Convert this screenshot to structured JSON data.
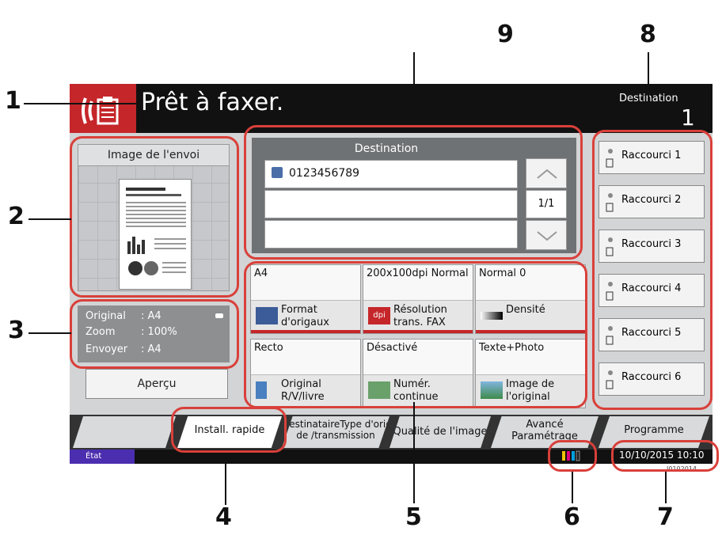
{
  "header": {
    "title": "Prêt à faxer.",
    "destination_label": "Destination",
    "destination_count": "1"
  },
  "preview": {
    "title": "Image de l'envoi"
  },
  "info": {
    "rows": [
      {
        "label": "Original",
        "value": ": A4"
      },
      {
        "label": "Zoom",
        "value": ": 100%"
      },
      {
        "label": "Envoyer",
        "value": ": A4"
      }
    ]
  },
  "apercu_label": "Aperçu",
  "destination_panel": {
    "title": "Destination",
    "entries": [
      "0123456789",
      "",
      ""
    ],
    "page_indicator": "1/1"
  },
  "functions": [
    {
      "value": "A4",
      "label": "Format d'origaux",
      "icon": "original-size-icon"
    },
    {
      "value": "200x100dpi Normal",
      "label": "Résolution trans. FAX",
      "icon": "dpi-icon"
    },
    {
      "value": "Normal 0",
      "label": "Densité",
      "icon": "density-icon"
    },
    {
      "value": "Recto",
      "label": "Original R/V/livre",
      "icon": "duplex-icon"
    },
    {
      "value": "Désactivé",
      "label": "Numér. continue",
      "icon": "continuous-scan-icon"
    },
    {
      "value": "Texte+Photo",
      "label": "Image de l'original",
      "icon": "original-image-icon"
    }
  ],
  "shortcuts": [
    "Raccourci 1",
    "Raccourci 2",
    "Raccourci 3",
    "Raccourci 4",
    "Raccourci 5",
    "Raccourci 6"
  ],
  "tabs": {
    "install": "Install. rapide",
    "dest_type": "Destinataire",
    "overlap": "Type d'original",
    "overlap2": "de /transmission",
    "image": "Qualité de l'image",
    "advanced": "Avancé Paramétrage",
    "program": "Programme"
  },
  "status": {
    "etat": "État",
    "datetime": "10/10/2015 10:10",
    "code": "I0102014"
  },
  "callouts": [
    "1",
    "2",
    "3",
    "4",
    "5",
    "6",
    "7",
    "8",
    "9"
  ],
  "colors": {
    "accent": "#c5262a",
    "highlight": "#d9403a",
    "state": "#4b2eb0"
  }
}
